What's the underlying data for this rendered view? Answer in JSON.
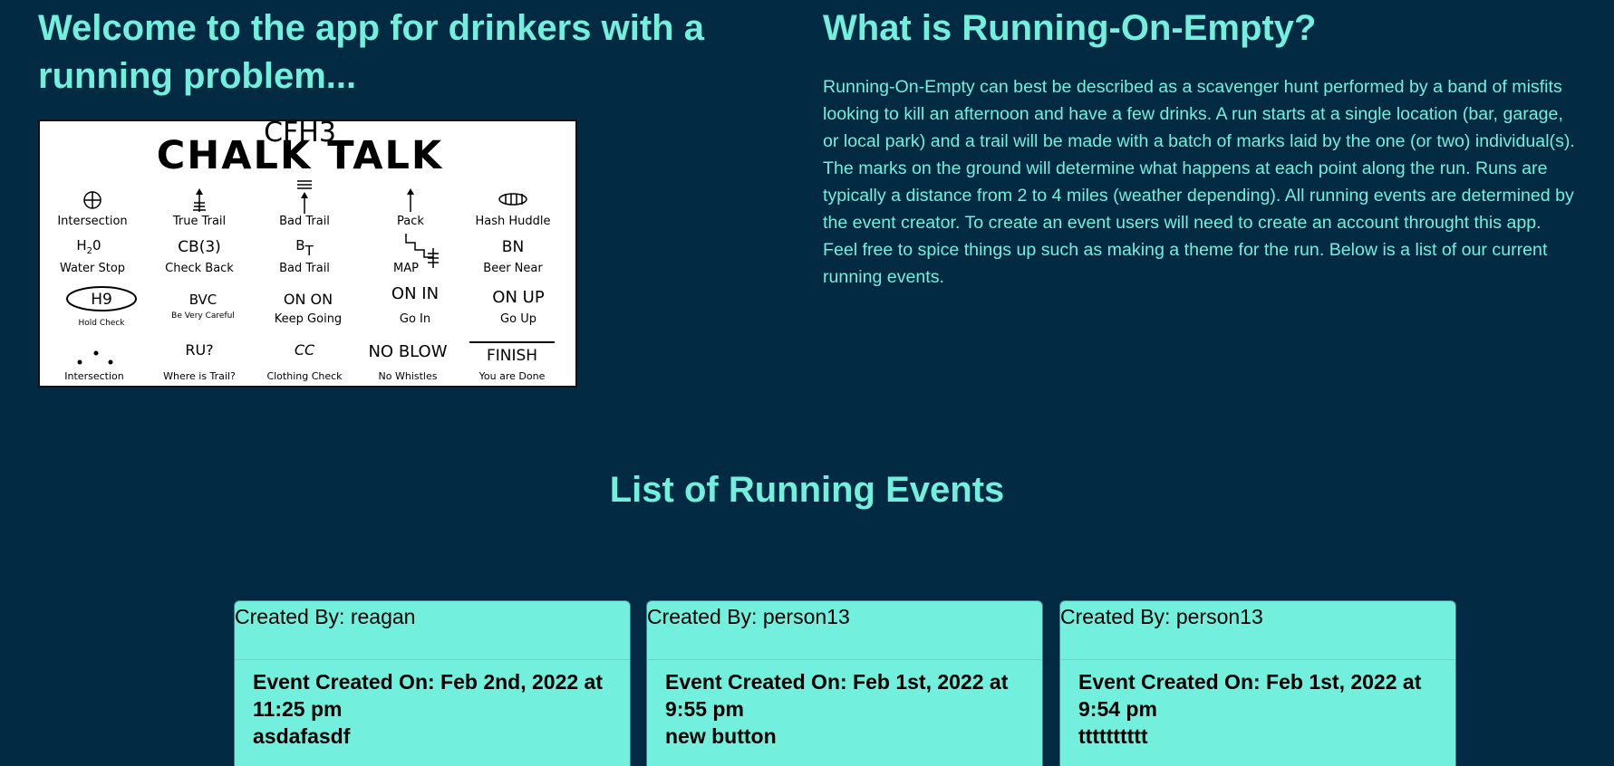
{
  "welcome": {
    "title": "Welcome to the app for drinkers with a running problem..."
  },
  "chalk_talk": {
    "group": "CFH3",
    "title": "CHALK TALK",
    "marks": [
      {
        "symbol": "⊕",
        "label": "Intersection"
      },
      {
        "symbol": "",
        "label": "True Trail"
      },
      {
        "symbol": "",
        "label": "Bad Trail"
      },
      {
        "symbol": "↑",
        "label": "Pack"
      },
      {
        "symbol": "",
        "label": "Hash Huddle"
      },
      {
        "symbol": "H2O",
        "label": "Water Stop"
      },
      {
        "symbol": "CB(3)",
        "label": "Check Back"
      },
      {
        "symbol": "BT",
        "label": "Bad Trail"
      },
      {
        "symbol": "",
        "label": "MAP"
      },
      {
        "symbol": "BN",
        "label": "Beer Near"
      },
      {
        "symbol": "H9",
        "label": "Hold Check"
      },
      {
        "symbol": "BVC",
        "label": "Be Very Careful"
      },
      {
        "symbol": "ON ON",
        "label": "Keep Going"
      },
      {
        "symbol": "ON IN",
        "label": "Go In"
      },
      {
        "symbol": "ON UP",
        "label": "Go Up"
      },
      {
        "symbol": "",
        "label": "Intersection"
      },
      {
        "symbol": "RU?",
        "label": "Where is Trail?"
      },
      {
        "symbol": "CC",
        "label": "Clothing Check"
      },
      {
        "symbol": "NO BLOW",
        "label": "No Whistles"
      },
      {
        "symbol": "FINISH",
        "label": "You are Done"
      }
    ]
  },
  "about": {
    "title": "What is Running-On-Empty?",
    "description": "Running-On-Empty can best be described as a scavenger hunt performed by a band of misfits looking to kill an afternoon and have a few drinks. A run starts at a single location (bar, garage, or local park) and a trail will be made with a batch of marks laid by the one (or two) individual(s). The marks on the ground will determine what happens at each point along the run. Runs are typically a distance from 2 to 4 miles (weather depending). All running events are determined by the event creator. To create an event users will need to create an account throught this app. Feel free to spice things up such as making a theme for the run. Below is a list of our current running events."
  },
  "events": {
    "title": "List of Running Events",
    "items": [
      {
        "created_by": "Created By: reagan",
        "created_on": "Event Created On: Feb 2nd, 2022 at 11:25 pm",
        "name": "asdafasdf"
      },
      {
        "created_by": "Created By: person13",
        "created_on": "Event Created On: Feb 1st, 2022 at 9:55 pm",
        "name": "new button"
      },
      {
        "created_by": "Created By: person13",
        "created_on": "Event Created On: Feb 1st, 2022 at 9:54 pm",
        "name": "tttttttttt"
      }
    ]
  },
  "colors": {
    "background": "#022b43",
    "accent": "#73efdd"
  }
}
